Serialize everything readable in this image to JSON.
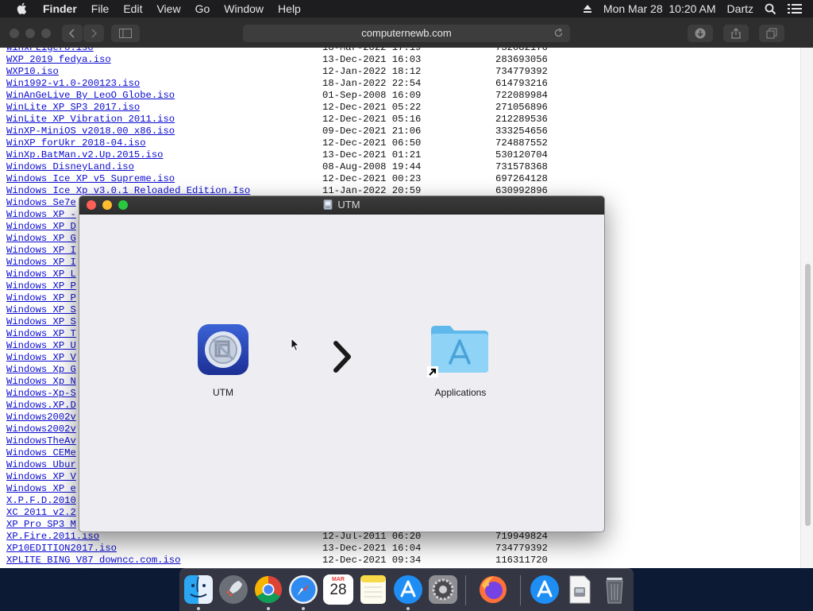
{
  "menubar": {
    "app_name": "Finder",
    "menus": [
      "File",
      "Edit",
      "View",
      "Go",
      "Window",
      "Help"
    ],
    "clock": "Mon Mar 28  10:20 AM",
    "user": "Dartz",
    "icons": [
      "apple-icon",
      "eject-icon",
      "spotlight-search-icon",
      "control-center-icon"
    ]
  },
  "browser": {
    "url": "computernewb.com",
    "toolbar_icons": [
      "back-icon",
      "forward-icon",
      "sidebar-icon",
      "reload-icon",
      "download-icon",
      "share-icon",
      "tabs-icon"
    ],
    "files": [
      {
        "name": "WinxPLigero.iso",
        "date": "18-Mar-2022 17:19",
        "size": "732082176"
      },
      {
        "name": "WXP 2019 fedya.iso",
        "date": "13-Dec-2021 16:03",
        "size": "283693056"
      },
      {
        "name": "WXP10.iso",
        "date": "12-Jan-2022 18:12",
        "size": "734779392"
      },
      {
        "name": "Win1992-v1.0-200123.iso",
        "date": "18-Jan-2022 22:54",
        "size": "614793216"
      },
      {
        "name": "WinAnGeLive By LeoO Globe.iso",
        "date": "01-Sep-2008 16:09",
        "size": "722089984"
      },
      {
        "name": "WinLite XP SP3 2017.iso",
        "date": "12-Dec-2021 05:22",
        "size": "271056896"
      },
      {
        "name": "WinLite XP Vibration 2011.iso",
        "date": "12-Dec-2021 05:16",
        "size": "212289536"
      },
      {
        "name": "WinXP-MiniOS v2018.00 x86.iso",
        "date": "09-Dec-2021 21:06",
        "size": "333254656"
      },
      {
        "name": "WinXP forUkr 2018-04.iso",
        "date": "12-Dec-2021 06:50",
        "size": "724887552"
      },
      {
        "name": "WinXp.BatMan.v2.Up.2015.iso",
        "date": "13-Dec-2021 01:21",
        "size": "530120704"
      },
      {
        "name": "Windows DisneyLand.iso",
        "date": "08-Aug-2008 19:44",
        "size": "731578368"
      },
      {
        "name": "Windows Ice XP v5 Supreme.iso",
        "date": "12-Dec-2021 00:23",
        "size": "697264128"
      },
      {
        "name": "Windows Ice Xp v3.0.1 Reloaded Edition.Iso",
        "date": "11-Jan-2022 20:59",
        "size": "630992896"
      },
      {
        "name": "Windows Se7e",
        "date": "",
        "size": ""
      },
      {
        "name": "Windows XP -",
        "date": "",
        "size": ""
      },
      {
        "name": "Windows XP D",
        "date": "",
        "size": ""
      },
      {
        "name": "Windows XP G",
        "date": "",
        "size": ""
      },
      {
        "name": "Windows XP I",
        "date": "",
        "size": ""
      },
      {
        "name": "Windows XP I",
        "date": "",
        "size": ""
      },
      {
        "name": "Windows XP L",
        "date": "",
        "size": ""
      },
      {
        "name": "Windows XP P",
        "date": "",
        "size": ""
      },
      {
        "name": "Windows XP P",
        "date": "",
        "size": ""
      },
      {
        "name": "Windows XP S",
        "date": "",
        "size": ""
      },
      {
        "name": "Windows XP S",
        "date": "",
        "size": ""
      },
      {
        "name": "Windows XP T",
        "date": "",
        "size": ""
      },
      {
        "name": "Windows XP U",
        "date": "",
        "size": ""
      },
      {
        "name": "Windows XP V",
        "date": "",
        "size": ""
      },
      {
        "name": "Windows Xp G",
        "date": "",
        "size": ""
      },
      {
        "name": "Windows Xp N",
        "date": "",
        "size": ""
      },
      {
        "name": "Windows-Xp-S",
        "date": "",
        "size": ""
      },
      {
        "name": "Windows.XP.D",
        "date": "",
        "size": ""
      },
      {
        "name": "Windows2002v",
        "date": "",
        "size": ""
      },
      {
        "name": "Windows2002v",
        "date": "",
        "size": ""
      },
      {
        "name": "WindowsTheAv",
        "date": "",
        "size": ""
      },
      {
        "name": "Windows CEMe",
        "date": "",
        "size": ""
      },
      {
        "name": "Windows Ubur",
        "date": "",
        "size": ""
      },
      {
        "name": "Windows XP V",
        "date": "",
        "size": ""
      },
      {
        "name": "Windows XP e",
        "date": "",
        "size": ""
      },
      {
        "name": "X.P.F.D.2010",
        "date": "",
        "size": ""
      },
      {
        "name": "XC 2011 v2.2",
        "date": "",
        "size": ""
      },
      {
        "name": "XP Pro SP3 M",
        "date": "",
        "size": ""
      },
      {
        "name": "XP.Fire.2011.iso",
        "date": "12-Jul-2011 06:20",
        "size": "719949824"
      },
      {
        "name": "XP10EDITION2017.iso",
        "date": "13-Dec-2021 16:04",
        "size": "734779392"
      },
      {
        "name": "XPLITE BING V87 downcc.com.iso",
        "date": "12-Dec-2021 09:34",
        "size": "116311720"
      }
    ]
  },
  "utm_window": {
    "title": "UTM",
    "app_label": "UTM",
    "folder_label": "Applications",
    "icons": [
      "utm-app-icon",
      "chevron-right-icon",
      "applications-folder-icon",
      "alias-arrow-icon",
      "disk-image-icon"
    ]
  },
  "dock": {
    "items": [
      "finder-icon",
      "launchpad-icon",
      "chrome-icon",
      "safari-icon",
      "calendar-icon",
      "notes-icon",
      "app-store-icon",
      "system-preferences-icon",
      "firefox-icon",
      "app-store-folder-icon",
      "utm-installer-icon",
      "trash-icon"
    ],
    "calendar_month": "MAR",
    "calendar_day": "28"
  },
  "colors": {
    "link": "#0a0ad0",
    "close": "#fe5f57",
    "minimize": "#febc2e",
    "zoom": "#28c840",
    "folder_blue": "#6cc4f0"
  }
}
